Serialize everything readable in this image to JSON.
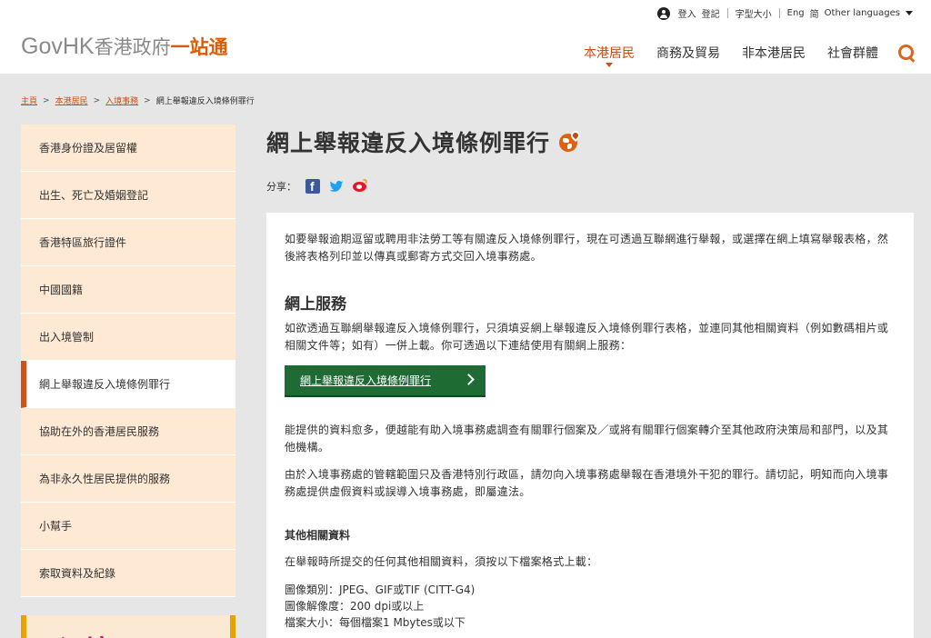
{
  "header": {
    "login": "登入",
    "register": "登記",
    "font_size": "字型大小",
    "lang_eng": "Eng",
    "lang_sc": "简",
    "other_languages": "Other languages",
    "logo_gov": "Gov",
    "logo_hk": "HK",
    "logo_zh": "香港政府",
    "logo_zh2": "一站通",
    "nav": [
      "本港居民",
      "商務及貿易",
      "非本港居民",
      "社會群體"
    ]
  },
  "breadcrumb": {
    "home": "主頁",
    "residents": "本港居民",
    "immigration": "入境事務",
    "current": "網上舉報違反入境條例罪行",
    "sep": ">"
  },
  "sidebar": {
    "items": [
      "香港身份證及居留權",
      "出生、死亡及婚姻登記",
      "香港特區旅行證件",
      "中國國籍",
      "出入境管制",
      "網上舉報違反入境條例罪行",
      "協助在外的香港居民服務",
      "為非永久性居民提供的服務",
      "小幫手",
      "索取資料及紀錄"
    ],
    "promo_text": "入境"
  },
  "main": {
    "title": "網上舉報違反入境條例罪行",
    "share_label": "分享：",
    "p1": "如要舉報逾期逗留或聘用非法勞工等有關違反入境條例罪行，現在可透過互聯網進行舉報，或選擇在網上填寫舉報表格，然後將表格列印並以傳真或郵寄方式交回入境事務處。",
    "online_heading": "網上服務",
    "p2": "如欲透過互聯網舉報違反入境條例罪行，只須填妥網上舉報違反入境條例罪行表格，並連同其他相關資料（例如數碼相片或相關文件等；如有）一併上載。你可透過以下連結使用有關網上服務：",
    "cta_label": "網上舉報違反入境條例罪行",
    "p3": "能提供的資料愈多，便越能有助入境事務處調查有關罪行個案及／或將有關罪行個案轉介至其他政府決策局和部門，以及其他機構。",
    "p4": "由於入境事務處的管轄範圍只及香港特別行政區，請勿向入境事務處舉報在香港境外干犯的罪行。請切記，明知而向入境事務處提供虛假資料或誤導入境事務處，即屬違法。",
    "other_heading": "其他相關資料",
    "p5": "在舉報時所提交的任何其他相關資料，須按以下檔案格式上載：",
    "spec_1": "圖像類別：JPEG、GIF或TIF (CITT-G4)",
    "spec_2": "圖像解像度：200 dpi或以上",
    "spec_3": "檔案大小：每個檔案1 Mbytes或以下"
  },
  "colors": {
    "accent": "#c8501a",
    "sidebar_bg": "#fde9d4",
    "cta_green": "#1f6b34",
    "page_bg": "#e6e6e6"
  }
}
